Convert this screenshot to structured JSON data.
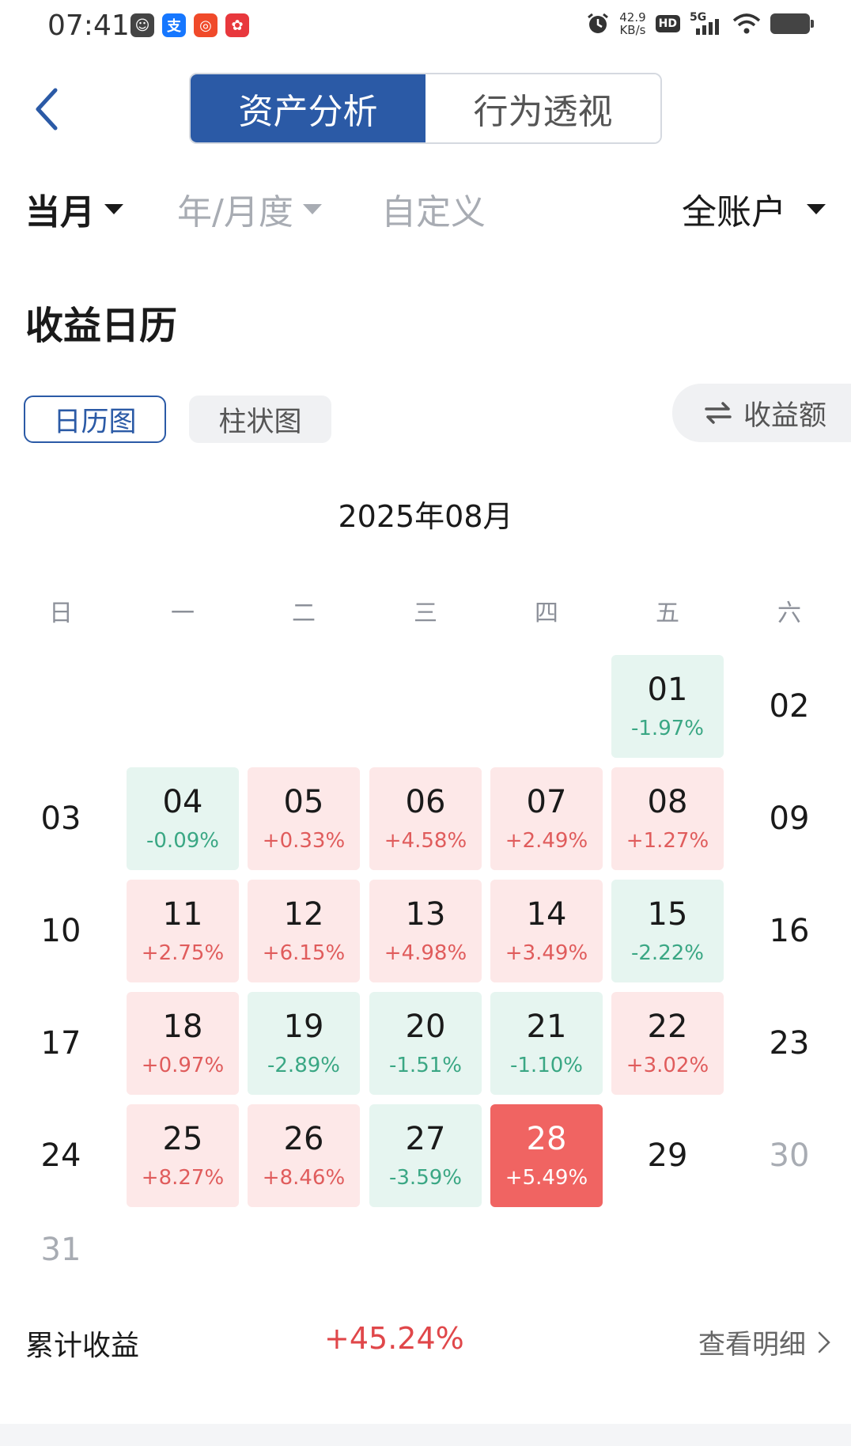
{
  "status_bar": {
    "time": "07:41",
    "net_speed_value": "42.9",
    "net_speed_unit": "KB/s",
    "hd": "HD",
    "network": "5G"
  },
  "header": {
    "tabs": [
      {
        "label": "资产分析",
        "active": true
      },
      {
        "label": "行为透视",
        "active": false
      }
    ]
  },
  "filters": {
    "current": "当月",
    "year_month": "年/月度",
    "custom": "自定义",
    "account": "全账户"
  },
  "section_title": "收益日历",
  "view_toggles": {
    "calendar": "日历图",
    "bar": "柱状图",
    "metric": "收益额"
  },
  "month_label": "2025年08月",
  "weekdays": [
    "日",
    "一",
    "二",
    "三",
    "四",
    "五",
    "六"
  ],
  "days": [
    {
      "day": "01",
      "pct": "-1.97%",
      "trend": "down"
    },
    {
      "day": "02"
    },
    {
      "day": "03"
    },
    {
      "day": "04",
      "pct": "-0.09%",
      "trend": "down"
    },
    {
      "day": "05",
      "pct": "+0.33%",
      "trend": "up"
    },
    {
      "day": "06",
      "pct": "+4.58%",
      "trend": "up"
    },
    {
      "day": "07",
      "pct": "+2.49%",
      "trend": "up"
    },
    {
      "day": "08",
      "pct": "+1.27%",
      "trend": "up"
    },
    {
      "day": "09"
    },
    {
      "day": "10"
    },
    {
      "day": "11",
      "pct": "+2.75%",
      "trend": "up"
    },
    {
      "day": "12",
      "pct": "+6.15%",
      "trend": "up"
    },
    {
      "day": "13",
      "pct": "+4.98%",
      "trend": "up"
    },
    {
      "day": "14",
      "pct": "+3.49%",
      "trend": "up"
    },
    {
      "day": "15",
      "pct": "-2.22%",
      "trend": "down"
    },
    {
      "day": "16"
    },
    {
      "day": "17"
    },
    {
      "day": "18",
      "pct": "+0.97%",
      "trend": "up"
    },
    {
      "day": "19",
      "pct": "-2.89%",
      "trend": "down"
    },
    {
      "day": "20",
      "pct": "-1.51%",
      "trend": "down"
    },
    {
      "day": "21",
      "pct": "-1.10%",
      "trend": "down"
    },
    {
      "day": "22",
      "pct": "+3.02%",
      "trend": "up"
    },
    {
      "day": "23"
    },
    {
      "day": "24"
    },
    {
      "day": "25",
      "pct": "+8.27%",
      "trend": "up"
    },
    {
      "day": "26",
      "pct": "+8.46%",
      "trend": "up"
    },
    {
      "day": "27",
      "pct": "-3.59%",
      "trend": "down"
    },
    {
      "day": "28",
      "pct": "+5.49%",
      "trend": "highlight"
    },
    {
      "day": "29"
    },
    {
      "day": "30",
      "muted": true
    },
    {
      "day": "31",
      "muted": true
    }
  ],
  "first_weekday": 5,
  "footer": {
    "cumulative_label": "累计收益",
    "cumulative_value": "+45.24%",
    "detail_link": "查看明细"
  },
  "colors": {
    "primary": "#2b5aa6",
    "gain_bg": "#fde8e8",
    "gain_text": "#e05c5c",
    "loss_bg": "#e6f5f0",
    "loss_text": "#3aa784",
    "highlight": "#f06462"
  }
}
